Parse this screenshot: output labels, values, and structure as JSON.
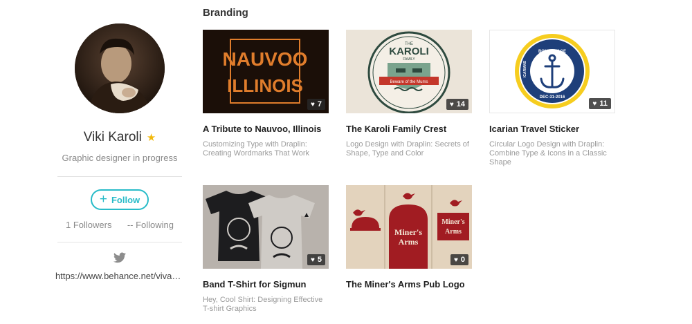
{
  "profile": {
    "name": "Viki Karoli",
    "tagline": "Graphic designer in progress",
    "follow_label": "Follow",
    "followers": "1 Followers",
    "following": "-- Following",
    "url": "https://www.behance.net/vivavikikaroli"
  },
  "section": {
    "title": "Branding"
  },
  "projects": [
    {
      "title": "A Tribute to Nauvoo, Illinois",
      "subtitle": "Customizing Type with Draplin: Creating Wordmarks That Work",
      "likes": "7",
      "art_text": [
        "NAUVOO",
        "ILLINOIS"
      ]
    },
    {
      "title": "The Karoli Family Crest",
      "subtitle": "Logo Design with Draplin: Secrets of Shape, Type and Color",
      "likes": "14",
      "art_text": [
        "THE",
        "KAROLI",
        "FAMILY",
        "Beware of the Mums"
      ]
    },
    {
      "title": "Icarian Travel Sticker",
      "subtitle": "Circular Logo Design with Draplin: Combine Type & Icons in a Classic Shape",
      "likes": "11",
      "art_text": [
        "BON VOYAGE",
        "ICARIANS",
        "DEC-31-2016"
      ]
    },
    {
      "title": "Band T-Shirt for Sigmun",
      "subtitle": "Hey, Cool Shirt: Designing Effective T-shirt Graphics",
      "likes": "5",
      "art_text": []
    },
    {
      "title": "The Miner's Arms Pub Logo",
      "subtitle": "",
      "likes": "0",
      "art_text": [
        "Miner's",
        "Arms",
        "Miner's",
        "Arms"
      ]
    }
  ],
  "colors": {
    "accent": "#27bbc8",
    "star": "#f2b90c"
  }
}
